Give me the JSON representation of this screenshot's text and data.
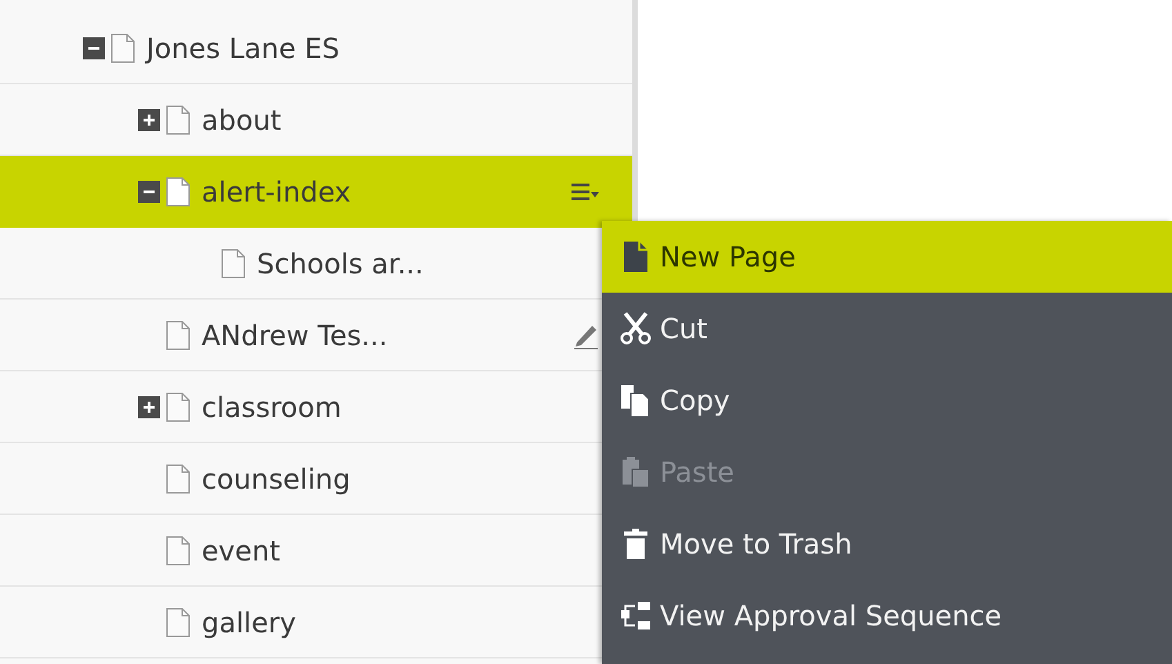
{
  "tree": [
    {
      "label": "Jones Lane ES",
      "expanded": true,
      "selected": false,
      "edit_icon": false,
      "children": [
        {
          "label": "about",
          "expanded": false,
          "selected": false,
          "edit_icon": false
        },
        {
          "label": "alert-index",
          "expanded": true,
          "selected": true,
          "edit_icon": false,
          "children": [
            {
              "label": "Schools ar...",
              "selected": false,
              "edit_icon": false
            }
          ]
        },
        {
          "label": "ANdrew Tes...",
          "selected": false,
          "edit_icon": true
        },
        {
          "label": "classroom",
          "expanded": false,
          "selected": false,
          "edit_icon": false
        },
        {
          "label": "counseling",
          "selected": false,
          "edit_icon": false
        },
        {
          "label": "event",
          "selected": false,
          "edit_icon": false
        },
        {
          "label": "gallery",
          "selected": false,
          "edit_icon": false
        }
      ]
    }
  ],
  "context_menu": [
    {
      "label": "New Page",
      "kind": "new-page",
      "selected": true,
      "disabled": false
    },
    {
      "label": "Cut",
      "kind": "cut",
      "selected": false,
      "disabled": false
    },
    {
      "label": "Copy",
      "kind": "copy",
      "selected": false,
      "disabled": false
    },
    {
      "label": "Paste",
      "kind": "paste",
      "selected": false,
      "disabled": true
    },
    {
      "label": "Move to Trash",
      "kind": "trash",
      "selected": false,
      "disabled": false
    },
    {
      "label": "View Approval Sequence",
      "kind": "approval",
      "selected": false,
      "disabled": false
    }
  ]
}
